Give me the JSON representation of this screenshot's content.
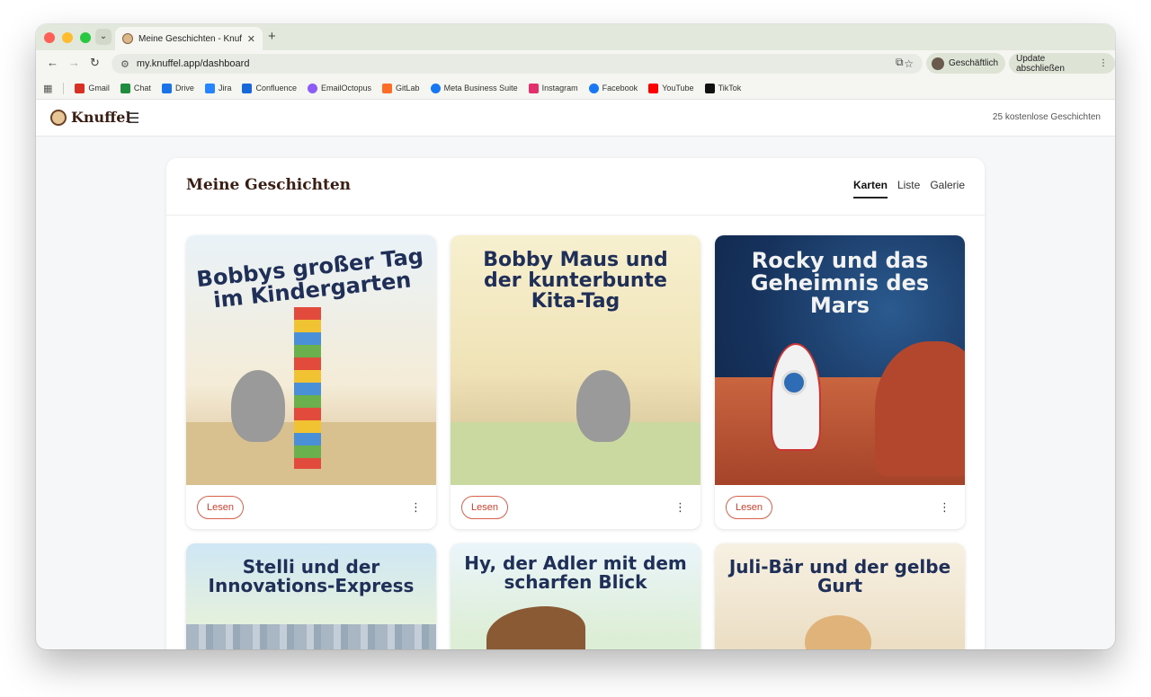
{
  "browser": {
    "tab_title": "Meine Geschichten - Knuffel",
    "url": "my.knuffel.app/dashboard",
    "profile_label": "Geschäftlich",
    "update_label": "Update abschließen",
    "bookmarks": [
      {
        "label": "Gmail",
        "color": "#d93025"
      },
      {
        "label": "Chat",
        "color": "#1e8e3e"
      },
      {
        "label": "Drive",
        "color": "#1a73e8"
      },
      {
        "label": "Jira",
        "color": "#2684ff"
      },
      {
        "label": "Confluence",
        "color": "#1868db"
      },
      {
        "label": "EmailOctopus",
        "color": "#8b5cf6"
      },
      {
        "label": "GitLab",
        "color": "#fc6d26"
      },
      {
        "label": "Meta Business Suite",
        "color": "#1877f2"
      },
      {
        "label": "Instagram",
        "color": "#e1306c"
      },
      {
        "label": "Facebook",
        "color": "#1877f2"
      },
      {
        "label": "YouTube",
        "color": "#ff0000"
      },
      {
        "label": "TikTok",
        "color": "#111111"
      }
    ]
  },
  "app": {
    "brand": "Knuffel",
    "free_stories": "25 kostenlose Geschichten",
    "page_title": "Meine Geschichten",
    "view_tabs": [
      "Karten",
      "Liste",
      "Galerie"
    ],
    "active_view": "Karten",
    "read_label": "Lesen",
    "stories": [
      {
        "title": "Bobbys großer Tag im Kindergarten"
      },
      {
        "title": "Bobby Maus und der kunterbunte Kita-Tag"
      },
      {
        "title": "Rocky und das Geheimnis des Mars"
      },
      {
        "title": "Stelli und der Innovations-Express"
      },
      {
        "title": "Hy, der Adler mit dem scharfen Blick"
      },
      {
        "title": "Juli-Bär und der gelbe Gurt"
      }
    ]
  },
  "colors": {
    "accent": "#c94330",
    "brand_text": "#3a1d12"
  }
}
